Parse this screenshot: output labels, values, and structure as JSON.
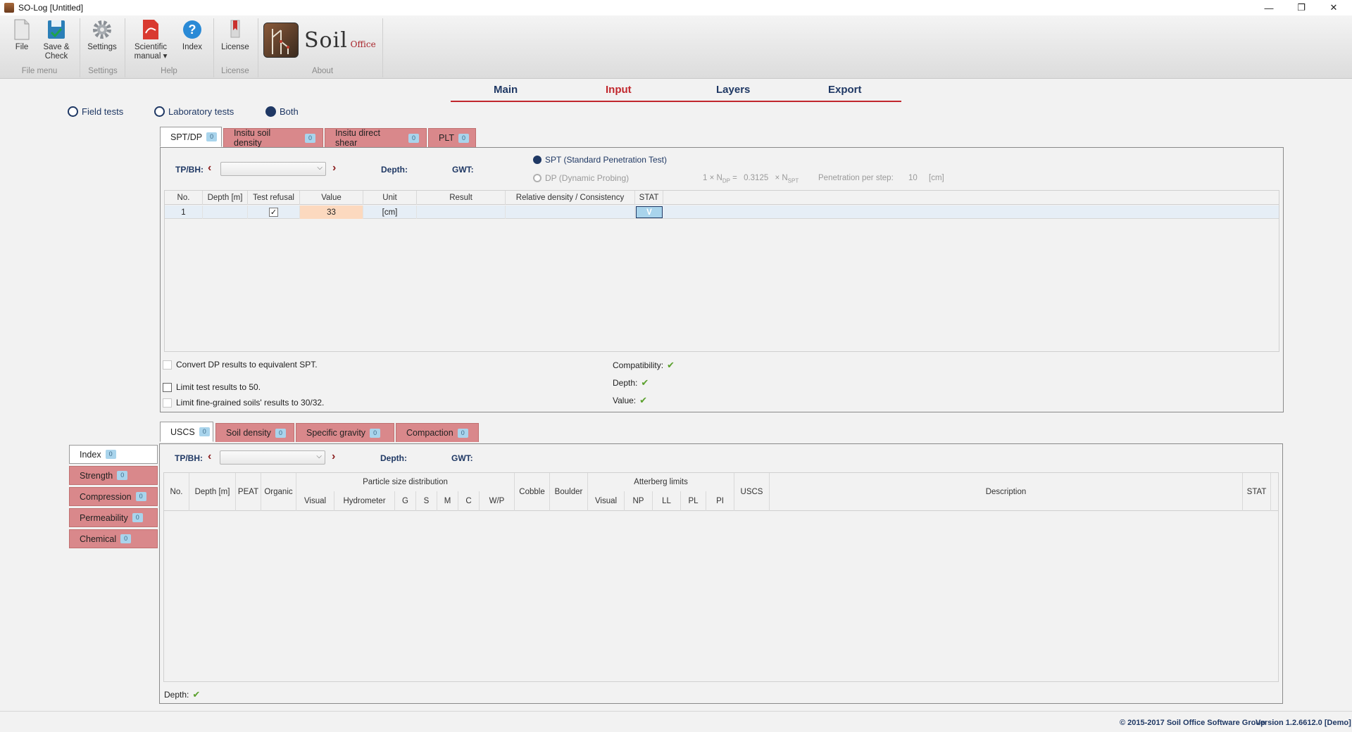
{
  "window": {
    "title": "SO-Log [Untitled]",
    "min": "—",
    "max": "❐",
    "close": "✕"
  },
  "ribbon": {
    "file": "File",
    "save_check_1": "Save &",
    "save_check_2": "Check",
    "settings": "Settings",
    "sci_manual_1": "Scientific",
    "sci_manual_2": "manual ▾",
    "index": "Index",
    "license": "License",
    "logo_text": "Soil",
    "logo_sub": "Office",
    "groups": {
      "file_menu": "File menu",
      "settings": "Settings",
      "help": "Help",
      "license": "License",
      "about": "About"
    }
  },
  "nav": {
    "main": "Main",
    "input": "Input",
    "layers": "Layers",
    "export": "Export"
  },
  "test_mode": {
    "field": "Field tests",
    "lab": "Laboratory tests",
    "both": "Both"
  },
  "field_tabs": [
    {
      "label": "SPT/DP",
      "count": "0"
    },
    {
      "label": "Insitu soil density",
      "count": "0"
    },
    {
      "label": "Insitu direct shear",
      "count": "0"
    },
    {
      "label": "PLT",
      "count": "0"
    }
  ],
  "field_panel": {
    "tp_bh": "TP/BH:",
    "depth": "Depth:",
    "gwt": "GWT:",
    "spt": "SPT (Standard Penetration Test)",
    "dp": "DP (Dynamic Probing)",
    "formula_left": "1 × N",
    "formula_sub1": "DP",
    "formula_eq": "=",
    "formula_factor": "0.3125",
    "formula_right": "× N",
    "formula_sub2": "SPT",
    "pen_label": "Penetration per step:",
    "pen_value": "10",
    "pen_unit": "[cm]",
    "columns": [
      "No.",
      "Depth [m]",
      "Test refusal",
      "Value",
      "Unit",
      "Result",
      "Relative density / Consistency",
      "STAT"
    ],
    "row": {
      "no": "1",
      "depth": "",
      "refusal_mark": "✓",
      "value": "33",
      "unit": "[cm]",
      "result": "",
      "rel": "",
      "stat": "V"
    },
    "convert": "Convert DP results to equivalent SPT.",
    "limit50": "Limit test results to 50.",
    "limit_fine": "Limit fine-grained soils' results to 30/32.",
    "compat": "Compatibility:",
    "depth_ok": "Depth:",
    "value_ok": "Value:",
    "check": "✔"
  },
  "lab_categories": [
    {
      "label": "Index",
      "count": "0"
    },
    {
      "label": "Strength",
      "count": "0"
    },
    {
      "label": "Compression",
      "count": "0"
    },
    {
      "label": "Permeability",
      "count": "0"
    },
    {
      "label": "Chemical",
      "count": "0"
    }
  ],
  "lab_tabs": [
    {
      "label": "USCS",
      "count": "0"
    },
    {
      "label": "Soil density",
      "count": "0"
    },
    {
      "label": "Specific gravity",
      "count": "0"
    },
    {
      "label": "Compaction",
      "count": "0"
    }
  ],
  "lab_panel": {
    "tp_bh": "TP/BH:",
    "depth": "Depth:",
    "gwt": "GWT:",
    "cols": {
      "no": "No.",
      "depth": "Depth [m]",
      "peat": "PEAT",
      "organic": "Organic",
      "psd": "Particle size distribution",
      "visual": "Visual",
      "hydrometer": "Hydrometer",
      "g": "G",
      "s": "S",
      "m": "M",
      "c": "C",
      "wp": "W/P",
      "cobble": "Cobble",
      "boulder": "Boulder",
      "atterberg": "Atterberg limits",
      "a_visual": "Visual",
      "np": "NP",
      "ll": "LL",
      "pl": "PL",
      "pi": "PI",
      "uscs": "USCS",
      "description": "Description",
      "stat": "STAT"
    },
    "depth_status": "Depth:",
    "check": "✔"
  },
  "footer": {
    "copyright": "© 2015-2017 Soil Office Software Group",
    "version": "Version 1.2.6612.0 [Demo]"
  }
}
